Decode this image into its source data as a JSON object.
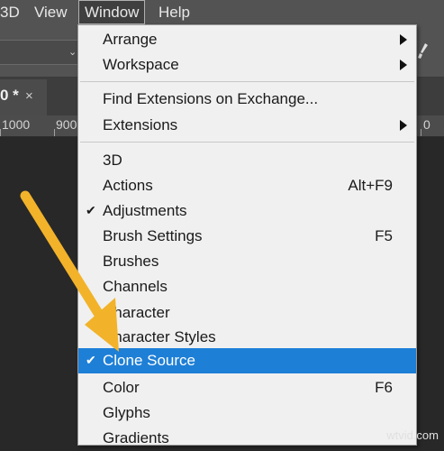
{
  "menubar": {
    "items": [
      {
        "label": "3D"
      },
      {
        "label": "View"
      },
      {
        "label": "Window"
      },
      {
        "label": "Help"
      }
    ]
  },
  "document": {
    "tab_title": "0 *",
    "tab_close": "×"
  },
  "ruler": {
    "labels": [
      "1000",
      "900",
      "0"
    ]
  },
  "window_menu": {
    "items": [
      {
        "label": "Arrange",
        "submenu": true
      },
      {
        "label": "Workspace",
        "submenu": true
      },
      {
        "label": "Find Extensions on Exchange..."
      },
      {
        "label": "Extensions",
        "submenu": true
      },
      {
        "label": "3D"
      },
      {
        "label": "Actions",
        "shortcut": "Alt+F9"
      },
      {
        "label": "Adjustments",
        "checked": true
      },
      {
        "label": "Brush Settings",
        "shortcut": "F5"
      },
      {
        "label": "Brushes"
      },
      {
        "label": "Channels"
      },
      {
        "label": "Character"
      },
      {
        "label": "Character Styles"
      },
      {
        "label": "Clone Source",
        "checked": true,
        "highlighted": true
      },
      {
        "label": "Color",
        "shortcut": "F6"
      },
      {
        "label": "Glyphs"
      },
      {
        "label": "Gradients"
      }
    ],
    "check_glyph": "✔",
    "highlight_color": "#1e7fd6"
  },
  "annotation": {
    "arrow_color": "#f2b32a"
  },
  "watermark": "wtvid.com"
}
